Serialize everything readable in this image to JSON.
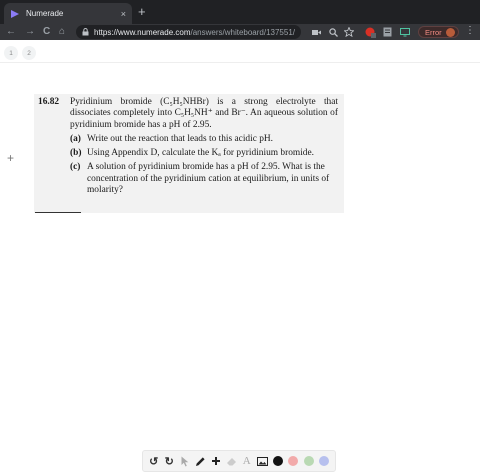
{
  "browser": {
    "tab_title": "Numerade",
    "tab_close": "×",
    "new_tab": "+",
    "nav_back": "←",
    "nav_forward": "→",
    "nav_reload": "C",
    "nav_home": "⌂",
    "url_main": "https://www.numerade.com",
    "url_path": "/answers/whiteboard/137551/",
    "error_label": "Error",
    "menu_icon": "⋮",
    "icons": [
      "video-camera-icon",
      "search-icon",
      "star-icon",
      "extension-red-icon",
      "extension-book-icon",
      "monitor-icon"
    ]
  },
  "page": {
    "tabs": [
      "1",
      "2"
    ],
    "side_plus": "+"
  },
  "problem": {
    "number": "16.82",
    "body": "Pyridinium bromide (C₅H₅NHBr) is a strong electrolyte that dissociates completely into C₅H₅NH⁺ and Br⁻. An aqueous solution of pyridinium bromide has a pH of 2.95.",
    "parts": [
      {
        "label": "(a)",
        "text": "Write out the reaction that leads to this acidic pH."
      },
      {
        "label": "(b)",
        "text": "Using Appendix D, calculate the Kₐ for pyridinium bromide."
      },
      {
        "label": "(c)",
        "text": "A solution of pyridinium bromide has a pH of 2.95. What is the concentration of the pyridinium cation at equilibrium, in units of molarity?"
      }
    ]
  },
  "draw_toolbar": {
    "undo": "↺",
    "redo": "↻",
    "text_tool": "A",
    "colors": [
      "#111111",
      "#f2aaaa",
      "#b9d9b3",
      "#b7c0ee"
    ]
  }
}
